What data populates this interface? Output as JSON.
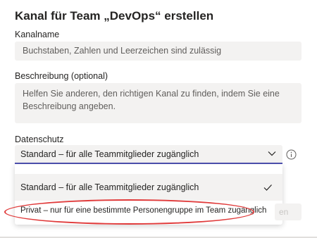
{
  "dialog": {
    "title": "Kanal für Team „DevOps“ erstellen"
  },
  "channel_name": {
    "label": "Kanalname",
    "placeholder": "Buchstaben, Zahlen und Leerzeichen sind zulässig"
  },
  "description": {
    "label": "Beschreibung (optional)",
    "placeholder": "Helfen Sie anderen, den richtigen Kanal zu finden, indem Sie eine Beschreibung angeben."
  },
  "privacy": {
    "label": "Datenschutz",
    "selected": "Standard – für alle Teammitglieder zugänglich",
    "options": [
      {
        "label": "Standard – für alle Teammitglieder zugänglich",
        "selected": true
      },
      {
        "label": "Privat – nur für eine bestimmte Personengruppe im Team zugänglich",
        "selected": false
      }
    ],
    "info_icon": "info-icon",
    "chevron_icon": "chevron-down-icon",
    "check_icon": "checkmark-icon"
  },
  "footer": {
    "partial_button_label": "en"
  },
  "colors": {
    "accent": "#4f52b2",
    "highlight_annotation": "#e03a3a",
    "field_bg": "#f3f2f1"
  }
}
